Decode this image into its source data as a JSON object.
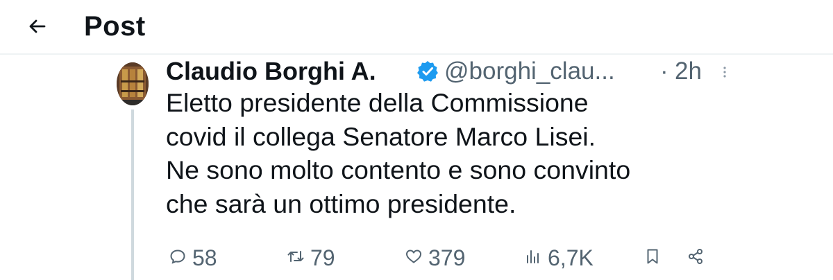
{
  "header": {
    "title": "Post"
  },
  "author": {
    "name": "Claudio Borghi A.",
    "handle": "@borghi_clau...",
    "separator": "·",
    "time": "2h",
    "verified_color": "#1d9bf0"
  },
  "tweet": {
    "lines": [
      "Eletto presidente della Commissione",
      "covid il collega Senatore Marco Lisei.",
      "Ne sono molto contento e sono convinto",
      "che sarà un ottimo presidente."
    ]
  },
  "stats": {
    "replies": "58",
    "reposts": "79",
    "likes": "379",
    "views": "6,7K"
  },
  "icons": {
    "back": "arrow-left-icon",
    "verified": "verified-badge-icon",
    "more": "more-vertical-icon",
    "reply": "reply-icon",
    "repost": "repost-icon",
    "like": "heart-icon",
    "views": "views-icon",
    "bookmark": "bookmark-icon",
    "share": "share-icon"
  },
  "colors": {
    "text": "#0f1419",
    "secondary": "#536471",
    "accent": "#1d9bf0",
    "divider": "#eff3f4"
  }
}
